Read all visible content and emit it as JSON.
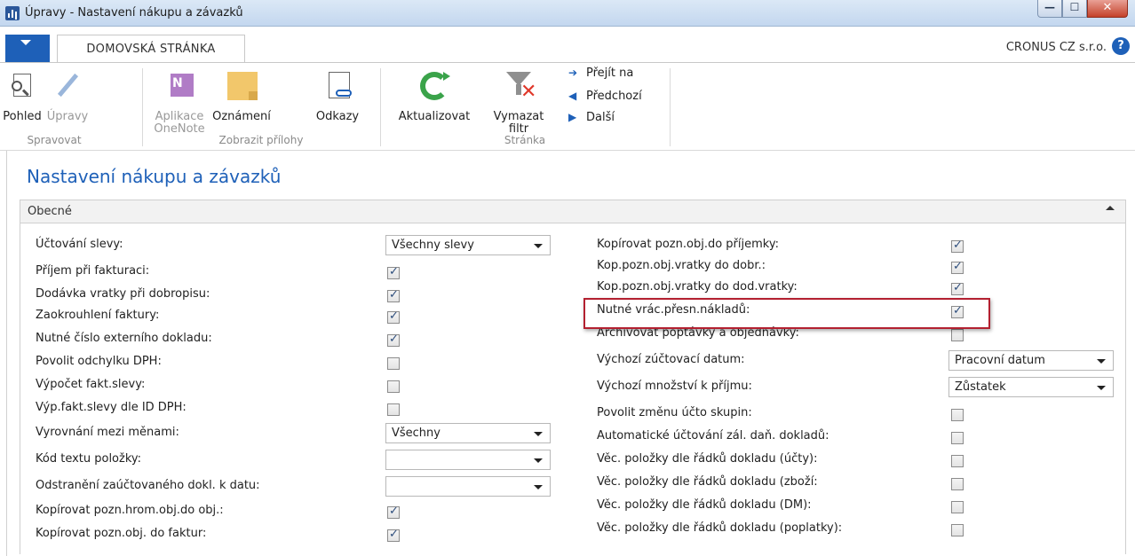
{
  "window": {
    "title": "Úpravy - Nastavení nákupu a závazků",
    "buttons": {
      "minimize": "—",
      "maximize": "☐",
      "close": "✕"
    }
  },
  "tabs": {
    "home": "DOMOVSKÁ STRÁNKA",
    "company": "CRONUS CZ s.r.o.",
    "help": "?"
  },
  "ribbon": {
    "view_line1": "Pohled",
    "edit_line1": "Úpravy",
    "onenote_line1": "Aplikace",
    "onenote_line2": "OneNote",
    "notes_line1": "Oznámení",
    "links_line1": "Odkazy",
    "refresh_line1": "Aktualizovat",
    "clear_filter_line1": "Vymazat",
    "clear_filter_line2": "filtr",
    "goto": "Přejít na",
    "previous": "Předchozí",
    "next": "Další",
    "group_manage": "Spravovat",
    "group_attachments": "Zobrazit přílohy",
    "group_page": "Stránka"
  },
  "page": {
    "title": "Nastavení nákupu a závazků",
    "section_title": "Obecné"
  },
  "left_fields": [
    {
      "label": "Účtování slevy:",
      "type": "select",
      "value": "Všechny slevy"
    },
    {
      "label": "Příjem při fakturaci:",
      "type": "checkbox",
      "checked": true
    },
    {
      "label": "Dodávka vratky při dobropisu:",
      "type": "checkbox",
      "checked": true
    },
    {
      "label": "Zaokrouhlení faktury:",
      "type": "checkbox",
      "checked": true
    },
    {
      "label": "Nutné číslo externího dokladu:",
      "type": "checkbox",
      "checked": true
    },
    {
      "label": "Povolit odchylku DPH:",
      "type": "checkbox",
      "checked": false
    },
    {
      "label": "Výpočet fakt.slevy:",
      "type": "checkbox",
      "checked": false
    },
    {
      "label": "Výp.fakt.slevy dle ID DPH:",
      "type": "checkbox",
      "checked": false
    },
    {
      "label": "Vyrovnání mezi měnami:",
      "type": "select",
      "value": "Všechny"
    },
    {
      "label": "Kód textu položky:",
      "type": "select",
      "value": ""
    },
    {
      "label": "Odstranění zaúčtovaného dokl. k datu:",
      "type": "select",
      "value": ""
    },
    {
      "label": "Kopírovat pozn.hrom.obj.do obj.:",
      "type": "checkbox",
      "checked": true
    },
    {
      "label": "Kopírovat pozn.obj. do faktur:",
      "type": "checkbox",
      "checked": true
    }
  ],
  "right_fields": [
    {
      "label": "Kopírovat pozn.obj.do příjemky:",
      "type": "checkbox",
      "checked": true
    },
    {
      "label": "Kop.pozn.obj.vratky do dobr.:",
      "type": "checkbox",
      "checked": true
    },
    {
      "label": "Kop.pozn.obj.vratky do dod.vratky:",
      "type": "checkbox",
      "checked": true
    },
    {
      "label": "Nutné vrác.přesn.nákladů:",
      "type": "checkbox",
      "checked": true
    },
    {
      "label": "Archivovat poptávky a objednávky:",
      "type": "checkbox",
      "checked": false
    },
    {
      "label": "Výchozí zúčtovací datum:",
      "type": "select",
      "value": "Pracovní datum"
    },
    {
      "label": "Výchozí množství k příjmu:",
      "type": "select",
      "value": "Zůstatek"
    },
    {
      "label": "Povolit změnu účto skupin:",
      "type": "checkbox",
      "checked": false
    },
    {
      "label": "Automatické účtování zál. daň. dokladů:",
      "type": "checkbox",
      "checked": false
    },
    {
      "label": "Věc. položky dle řádků dokladu (účty):",
      "type": "checkbox",
      "checked": false
    },
    {
      "label": "Věc. položky dle řádků dokladu (zboží:",
      "type": "checkbox",
      "checked": false
    },
    {
      "label": "Věc. položky dle řádků dokladu (DM):",
      "type": "checkbox",
      "checked": false
    },
    {
      "label": "Věc. položky dle řádků dokladu (poplatky):",
      "type": "checkbox",
      "checked": false
    }
  ],
  "colors": {
    "accent": "#1e60b8",
    "highlight": "#b32030"
  }
}
